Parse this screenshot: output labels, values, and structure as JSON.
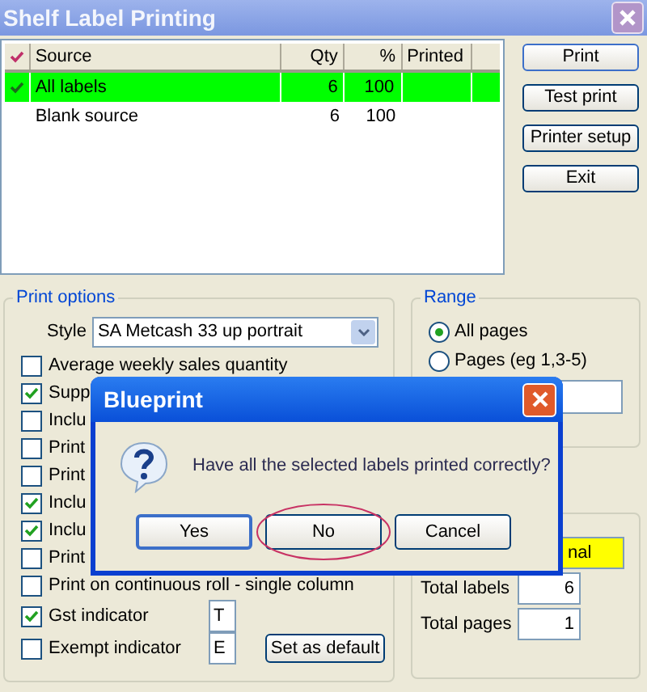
{
  "window": {
    "title": "Shelf Label Printing"
  },
  "labels_table": {
    "columns": [
      "Source",
      "Qty",
      "%",
      "Printed"
    ],
    "rows": [
      {
        "source": "All labels",
        "qty": "6",
        "percent": "100",
        "checked": true,
        "selected": true
      },
      {
        "source": "Blank source",
        "qty": "6",
        "percent": "100",
        "checked": false,
        "selected": false
      }
    ]
  },
  "side_buttons": [
    "Print",
    "Test print",
    "Printer setup",
    "Exit"
  ],
  "print_options": {
    "label": "Print options",
    "style_label": "Style",
    "style_value": "SA Metcash 33 up portrait",
    "options": [
      {
        "kind": "check",
        "label": "Average weekly sales quantity",
        "checked": false
      },
      {
        "kind": "check",
        "label": "Supp",
        "checked": true
      },
      {
        "kind": "check",
        "label": "Inclu",
        "checked": false
      },
      {
        "kind": "check",
        "label": "Print",
        "checked": false
      },
      {
        "kind": "check",
        "label": "Print",
        "checked": false
      },
      {
        "kind": "check",
        "label": "Inclu",
        "checked": true
      },
      {
        "kind": "check",
        "label": "Inclu",
        "checked": true
      },
      {
        "kind": "check",
        "label": "Print",
        "checked": false
      },
      {
        "kind": "check",
        "label": "Print on continuous roll - single column",
        "checked": false
      },
      {
        "kind": "field",
        "label": "Gst indicator",
        "checked": true,
        "value": "T"
      },
      {
        "kind": "field",
        "label": "Exempt indicator",
        "checked": false,
        "value": "E"
      }
    ],
    "default_button": "Set as default"
  },
  "range": {
    "label": "Range",
    "options": [
      {
        "label": "All pages",
        "selected": true
      },
      {
        "label": "Pages (eg 1,3-5)",
        "selected": false
      }
    ]
  },
  "totals": {
    "mode_value": "nal",
    "rows": [
      {
        "label": "Total labels",
        "value": "6"
      },
      {
        "label": "Total pages",
        "value": "1"
      }
    ]
  },
  "dialog": {
    "title": "Blueprint",
    "message": "Have all the selected labels printed correctly?",
    "buttons": [
      {
        "label": "Yes",
        "circled": false
      },
      {
        "label": "No",
        "circled": true
      },
      {
        "label": "Cancel",
        "circled": false
      }
    ]
  }
}
